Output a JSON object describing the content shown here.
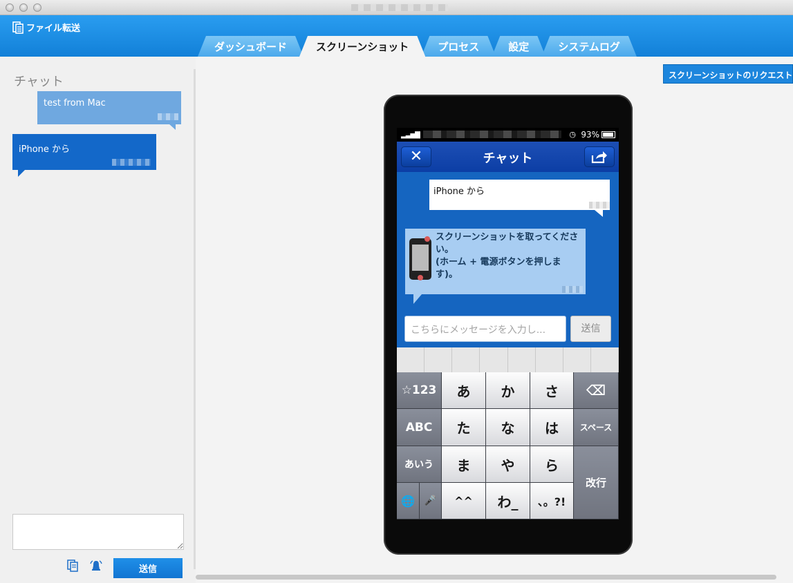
{
  "window": {
    "title": "",
    "buttons": [
      "close",
      "minimize",
      "zoom"
    ]
  },
  "header": {
    "app_name": "ファイル転送",
    "logo_icon": "file-transfer-icon"
  },
  "tabs": [
    {
      "label": "ダッシュボード",
      "active": false
    },
    {
      "label": "スクリーンショット",
      "active": true
    },
    {
      "label": "プロセス",
      "active": false
    },
    {
      "label": "設定",
      "active": false
    },
    {
      "label": "システムログ",
      "active": false
    }
  ],
  "sidebar": {
    "title": "チャット",
    "messages": [
      {
        "text": "test from Mac",
        "from": "mac"
      },
      {
        "text": "iPhone から",
        "from": "iphone"
      }
    ],
    "input_value": "",
    "tools": [
      "clipboard-icon",
      "alert-icon"
    ],
    "send_label": "送信"
  },
  "main": {
    "request_button": "スクリーンショットのリクエスト"
  },
  "phone": {
    "status": {
      "battery": "93%",
      "signal_icon": "signal-bars-icon",
      "alarm_icon": "clock-icon"
    },
    "nav_title": "チャット",
    "close_icon": "close-icon",
    "share_icon": "share-icon",
    "messages": [
      {
        "text": "iPhone から",
        "style": "white"
      },
      {
        "text": "スクリーンショットを取ってください。\n(ホーム + 電源ボタンを押します)。",
        "style": "blue"
      }
    ],
    "input_placeholder": "こちらにメッセージを入力し...",
    "send_label": "送信",
    "keyboard": {
      "row1": [
        "☆123",
        "あ",
        "か",
        "さ",
        "⌫"
      ],
      "row2": [
        "ABC",
        "た",
        "な",
        "は",
        "スペース"
      ],
      "row3": [
        "あいう",
        "ま",
        "や",
        "ら",
        "改行"
      ],
      "row4": [
        "🌐",
        "🎤",
        "^^",
        "わ_",
        "、。?!"
      ]
    }
  },
  "colors": {
    "header_blue": "#1a8ae6",
    "accent": "#1275d2",
    "phone_blue": "#1565c0"
  }
}
